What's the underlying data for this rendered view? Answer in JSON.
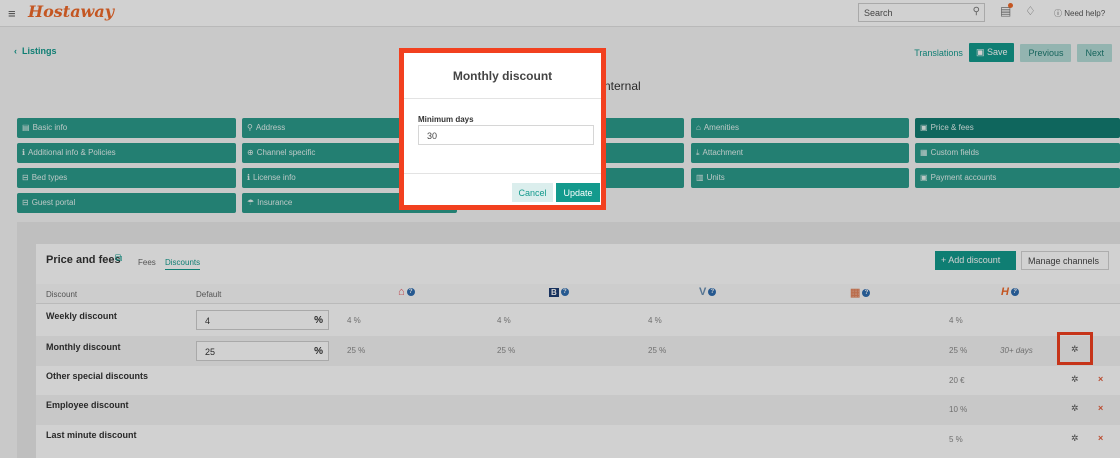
{
  "app": {
    "logo": "Hostaway",
    "search_placeholder": "Search",
    "help": "Need help?"
  },
  "nav": {
    "back": "Listings",
    "translations": "Translations",
    "save": "Save",
    "previous": "Previous",
    "next": "Next",
    "page_title_fragment": "nternal"
  },
  "tabs": [
    {
      "label": "Basic info",
      "icon": "▤"
    },
    {
      "label": "Address",
      "icon": "⚲"
    },
    {
      "label": "Amenities",
      "icon": "⌂"
    },
    {
      "label": "Price & fees",
      "icon": "▣"
    },
    {
      "label": "Additional info & Policies",
      "icon": "ℹ"
    },
    {
      "label": "Channel specific",
      "icon": "⊕"
    },
    {
      "label": "Attachment",
      "icon": "⤓"
    },
    {
      "label": "Custom fields",
      "icon": "▦"
    },
    {
      "label": "Bed types",
      "icon": "⊟"
    },
    {
      "label": "License info",
      "icon": "ℹ"
    },
    {
      "label": "Units",
      "icon": "▥"
    },
    {
      "label": "Payment accounts",
      "icon": "▣"
    },
    {
      "label": "Guest portal",
      "icon": "⊟"
    },
    {
      "label": "Insurance",
      "icon": "☂"
    }
  ],
  "section": {
    "title": "Price and fees",
    "subtab_fees": "Fees",
    "subtab_discounts": "Discounts",
    "add_discount": "+ Add discount",
    "manage_channels": "Manage channels"
  },
  "table": {
    "col_discount": "Discount",
    "col_default": "Default",
    "rows": [
      {
        "name": "Weekly discount",
        "default": "4",
        "airbnb": "4 %",
        "booking": "4 %",
        "vrbo": "4 %",
        "hostaway": "4 %",
        "extra": ""
      },
      {
        "name": "Monthly discount",
        "default": "25",
        "airbnb": "25 %",
        "booking": "25 %",
        "vrbo": "25 %",
        "hostaway": "25 %",
        "extra": "30+ days"
      },
      {
        "name": "Other special discounts",
        "hostaway": "20 €"
      },
      {
        "name": "Employee discount",
        "hostaway": "10 %"
      },
      {
        "name": "Last minute discount",
        "hostaway": "5 %"
      }
    ]
  },
  "modal": {
    "title": "Monthly discount",
    "label": "Minimum days",
    "value": "30",
    "cancel": "Cancel",
    "update": "Update"
  }
}
